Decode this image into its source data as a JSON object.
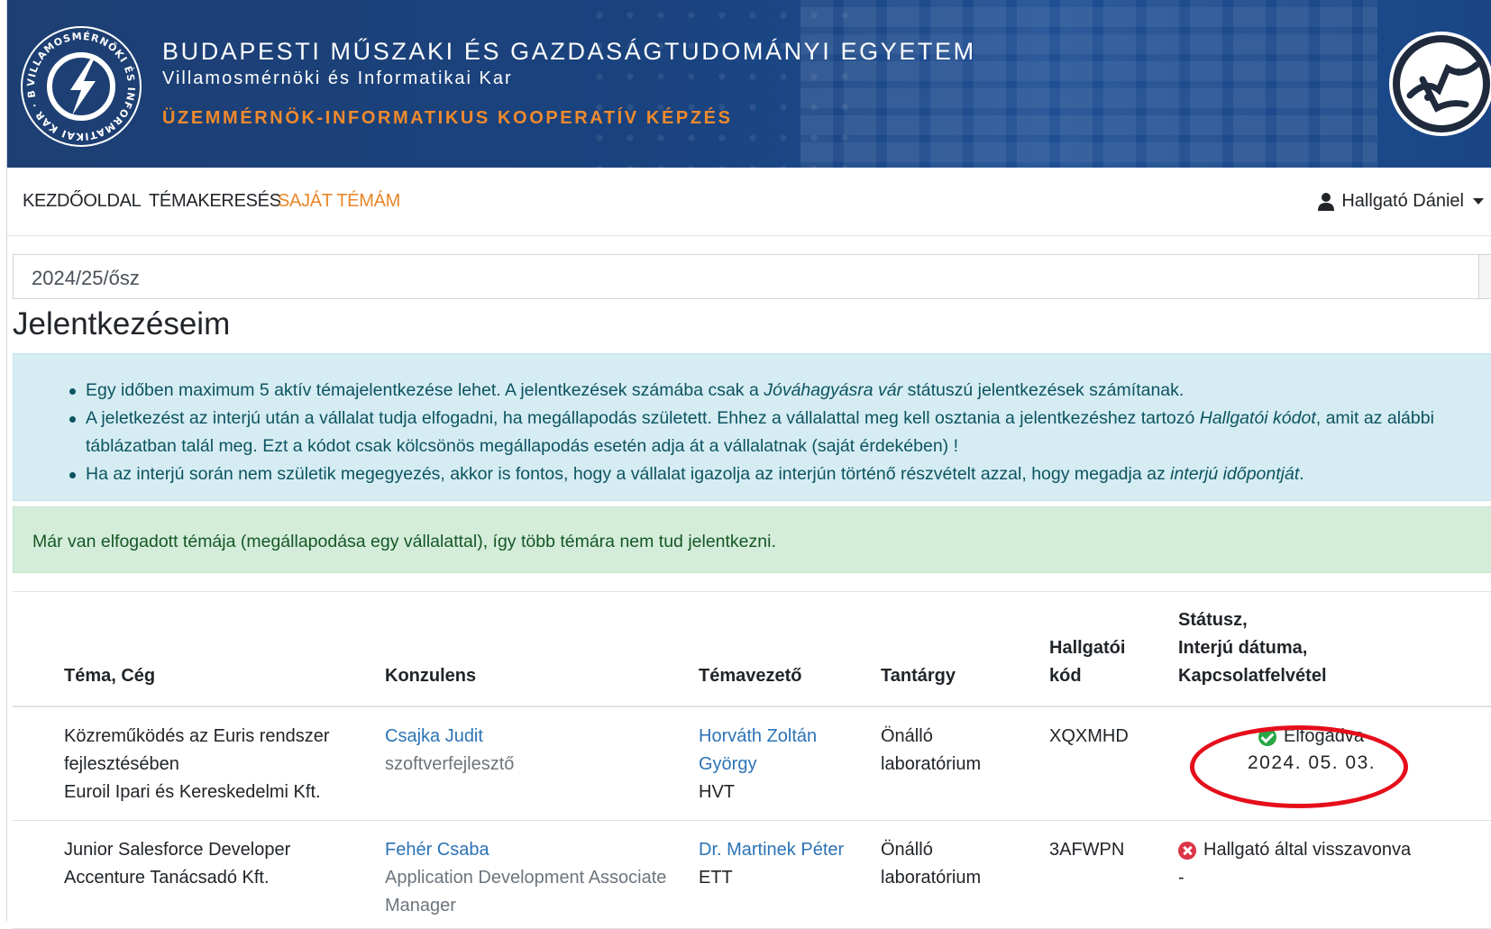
{
  "banner": {
    "university": "BUDAPESTI MŰSZAKI ÉS GAZDASÁGTUDOMÁNYI EGYETEM",
    "faculty": "Villamosmérnöki és Informatikai Kar",
    "program": "ÜZEMMÉRNÖK-INFORMATIKUS KOOPERATÍV KÉPZÉS",
    "logo_text": "VILLAMOSMÉRNÖKI ÉS INFORMATIKAI KAR · BME"
  },
  "nav": {
    "items": [
      "KEZDŐOLDAL",
      "TÉMAKERESÉS",
      "SAJÁT TÉMÁM"
    ],
    "active_index": 2,
    "user_name": "Hallgató Dániel"
  },
  "semester": {
    "selected": "2024/25/ősz"
  },
  "page": {
    "title": "Jelentkezéseim"
  },
  "info": {
    "bullet1_a": "Egy időben maximum 5 aktív témajelentkezése lehet. A jelentkezések számába csak a ",
    "bullet1_em": "Jóváhagyásra vár",
    "bullet1_b": " státuszú jelentkezések számítanak.",
    "bullet2_a": "A jeletkezést az interjú után a vállalat tudja elfogadni, ha megállapodás született. Ehhez a vállalattal meg kell osztania a jelentkezéshez tartozó ",
    "bullet2_em": "Hallgatói kódot",
    "bullet2_b": ", amit az alábbi táblázatban talál meg. Ezt a kódot csak kölcsönös megállapodás esetén adja át a vállalatnak (saját érdekében) !",
    "bullet3_a": "Ha az interjú során nem születik megegyezés, akkor is fontos, hogy a vállalat igazolja az interjún történő részvételt azzal, hogy megadja az ",
    "bullet3_em": "interjú időpontját",
    "bullet3_b": "."
  },
  "success": {
    "text": "Már van elfogadott témája (megállapodása egy vállalattal), így több témára nem tud jelentkezni."
  },
  "table": {
    "headers": {
      "topic": "Téma, Cég",
      "consultant": "Konzulens",
      "supervisor": "Témavezető",
      "subject": "Tantárgy",
      "code_line1": "Hallgatói",
      "code_line2": "kód",
      "status_line1": "Státusz,",
      "status_line2": "Interjú dátuma,",
      "status_line3": "Kapcsolatfelvétel"
    },
    "rows": [
      {
        "topic_line1": "Közreműködés az Euris rendszer",
        "topic_line2": "fejlesztésében",
        "company": "Euroil Ipari és Kereskedelmi Kft.",
        "consultant_name": "Csajka Judit",
        "consultant_role": "szoftverfejlesztő",
        "supervisor_line1": "Horváth Zoltán",
        "supervisor_line2": "György",
        "supervisor_dept": "HVT",
        "subject_line1": "Önálló",
        "subject_line2": "laboratórium",
        "code": "XQXMHD",
        "status": "Elfogadva",
        "interview_date": "2024. 05. 03."
      },
      {
        "topic_line1": "Junior Salesforce Developer",
        "company": "Accenture Tanácsadó Kft.",
        "consultant_name": "Fehér Csaba",
        "consultant_role_line1": "Application Development Associate",
        "consultant_role_line2": "Manager",
        "supervisor_line1": "Dr. Martinek Péter",
        "supervisor_dept": "ETT",
        "subject_line1": "Önálló",
        "subject_line2": "laboratórium",
        "code": "3AFWPN",
        "status": "Hallgató által visszavonva",
        "interview_date": "-"
      }
    ]
  },
  "colors": {
    "banner_bg": "#1a437f",
    "accent_orange": "#e8862a",
    "link_blue": "#2b73b6",
    "info_bg": "#d6ecf3",
    "success_bg": "#d4edda",
    "status_ok": "#28a745",
    "status_cancelled": "#dc3545",
    "annotation_red": "#e50e1b"
  }
}
